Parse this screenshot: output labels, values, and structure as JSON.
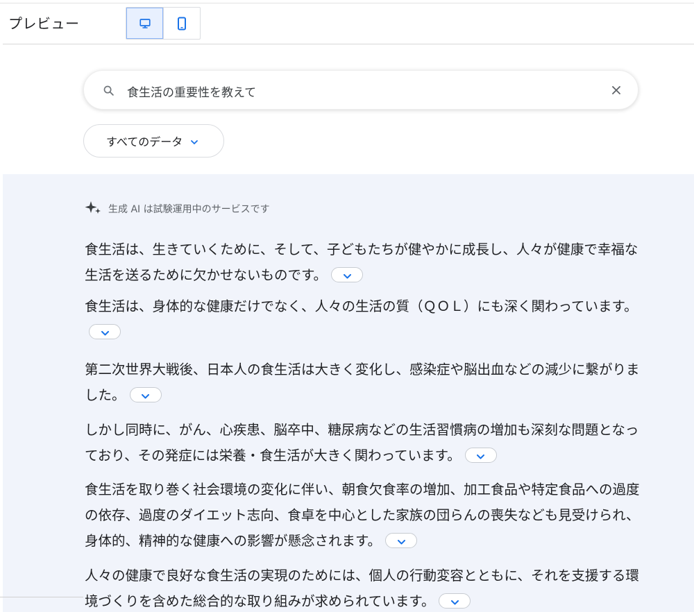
{
  "header": {
    "title": "プレビュー",
    "device_buttons": [
      {
        "icon": "desktop-icon",
        "active": true
      },
      {
        "icon": "mobile-icon",
        "active": false
      }
    ]
  },
  "search": {
    "query": "食生活の重要性を教えて",
    "icon": "search-icon",
    "clear_icon": "close-icon"
  },
  "filter": {
    "label": "すべてのデータ",
    "icon": "chevron-down-icon"
  },
  "ai": {
    "notice": "生成 AI は試験運用中のサービスです",
    "notice_icon": "sparkle-icon",
    "paragraphs": [
      "食生活は、生きていくために、そして、子どもたちが健やかに成長し、人々が健康で幸福な生活を送るために欠かせないものです。",
      "食生活は、身体的な健康だけでなく、人々の生活の質（ＱＯＬ）にも深く関わっています。",
      "第二次世界大戦後、日本人の食生活は大きく変化し、感染症や脳出血などの減少に繋がりました。",
      "しかし同時に、がん、心疾患、脳卒中、糖尿病などの生活習慣病の増加も深刻な問題となっており、その発症には栄養・食生活が大きく関わっています。",
      "食生活を取り巻く社会環境の変化に伴い、朝食欠食率の増加、加工食品や特定食品への過度の依存、過度のダイエット志向、食卓を中心とした家族の団らんの喪失なども見受けられ、身体的、精神的な健康への影響が懸念されます。",
      "人々の健康で良好な食生活の実現のためには、個人の行動変容とともに、それを支援する環境づくりを含めた総合的な取り組みが求められています。"
    ]
  },
  "colors": {
    "accent": "#1a73e8",
    "panel_bg": "#f1f4fb",
    "active_device_bg": "#e8f0fe"
  }
}
